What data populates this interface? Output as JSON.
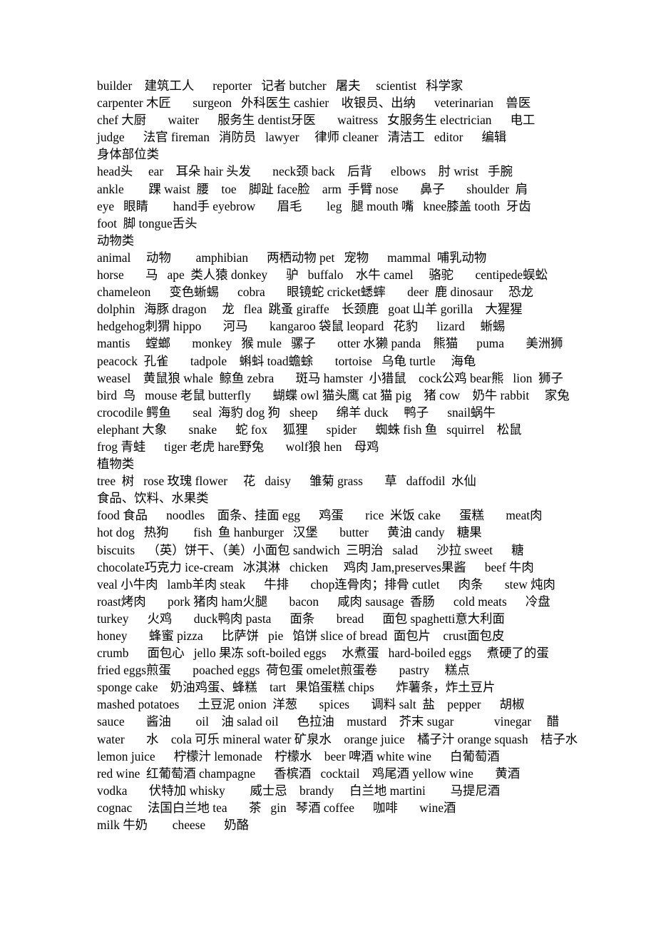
{
  "document": {
    "type": "vocabulary-word-list",
    "language_pair": "English-Chinese",
    "sections": [
      {
        "heading": null,
        "category_key": "occupations",
        "lines": [
          "builder    建筑工人      reporter   记者 butcher   屠夫     scientist   科学家",
          "carpenter 木匠       surgeon   外科医生 cashier    收银员、出纳      veterinarian    兽医",
          "chef 大厨       waiter      服务生 dentist牙医       waitress   女服务生 electrician      电工",
          "judge      法官 fireman   消防员   lawyer     律师 cleaner   清洁工   editor      编辑"
        ]
      },
      {
        "heading": "身体部位类",
        "category_key": "body-parts",
        "lines": [
          "head头     ear    耳朵 hair 头发       neck颈 back    后背      elbows    肘 wrist   手腕",
          "ankle        踝 waist  腰    toe    脚趾 face脸    arm  手臂 nose       鼻子       shoulder  肩",
          "eye   眼睛        hand手 eyebrow       眉毛        leg   腿 mouth 嘴   knee膝盖 tooth  牙齿",
          "foot  脚 tongue舌头"
        ]
      },
      {
        "heading": "动物类",
        "category_key": "animals",
        "lines": [
          "animal     动物        amphibian      两栖动物 pet   宠物      mammal  哺乳动物",
          "horse       马   ape  类人猿 donkey      驴   buffalo    水牛 camel     骆驼       centipede蜈蚣",
          "chameleon      变色蜥蜴      cobra       眼镜蛇 cricket蟋蟀       deer  鹿 dinosaur     恐龙",
          "dolphin   海豚 dragon     龙   flea  跳蚤 giraffe    长颈鹿   goat 山羊 gorilla    大猩猩",
          "hedgehog刺猬 hippo       河马       kangaroo 袋鼠 leopard   花豹      lizard     蜥蜴",
          "mantis     螳螂       monkey   猴 mule   骡子       otter 水獭 panda    熊猫      puma       美洲狮",
          "peacock  孔雀       tadpole    蝌蚪 toad蟾蜍       tortoise   乌龟 turtle     海龟",
          "weasel    黄鼠狼 whale  鲸鱼 zebra       斑马 hamster  小猎鼠    cock公鸡 bear熊   lion  狮子",
          "bird  鸟   mouse 老鼠 butterfly       蝴蝶 owl 猫头鹰 cat 猫 pig    猪 cow    奶牛 rabbit     家兔",
          "crocodile 鳄鱼       seal  海豹 dog 狗   sheep      绵羊 duck     鸭子      snail蜗牛",
          "elephant 大象       snake      蛇 fox     狐狸      spider      蜘蛛 fish 鱼   squirrel    松鼠",
          "frog 青蛙      tiger 老虎 hare野兔       wolf狼 hen    母鸡"
        ]
      },
      {
        "heading": "植物类",
        "category_key": "plants",
        "lines": [
          "tree  树   rose 玫瑰 flower     花   daisy      雏菊 grass       草   daffodil  水仙"
        ]
      },
      {
        "heading": "食品、饮料、水果类",
        "category_key": "food-drink-fruit",
        "lines": [
          "food 食品      noodles    面条、挂面 egg      鸡蛋       rice  米饭 cake      蛋糕       meat肉",
          "hot dog   热狗        fish  鱼 hanburger   汉堡       butter      黄油 candy    糖果",
          "biscuits    （英）饼干、（美）小面包 sandwich  三明治   salad      沙拉 sweet      糖",
          "chocolate巧克力 ice-cream   冰淇淋   chicken     鸡肉 Jam,preserves果酱      beef 牛肉",
          "veal 小牛肉   lamb羊肉 steak      牛排       chop连骨肉；排骨 cutlet      肉条       stew 炖肉",
          "roast烤肉       pork 猪肉 ham火腿       bacon      咸肉 sausage  香肠      cold meats      冷盘",
          "turkey      火鸡       duck鸭肉 pasta      面条       bread      面包 spaghetti意大利面",
          "honey       蜂蜜 pizza      比萨饼   pie   馅饼 slice of bread  面包片    crust面包皮",
          "crumb      面包心   jello 果冻 soft-boiled eggs     水煮蛋   hard-boiled eggs     煮硬了的蛋",
          "fried eggs煎蛋       poached eggs  荷包蛋 omelet煎蛋卷       pastry     糕点",
          "sponge cake    奶油鸡蛋、蜂糕    tart   果馅蛋糕 chips       炸薯条，炸土豆片",
          "mashed potatoes      土豆泥 onion  洋葱       spices       调料 salt  盐    pepper      胡椒",
          "sauce       酱油        oil    油 salad oil      色拉油    mustard    芥末 sugar             vinegar     醋",
          "water       水    cola 可乐 mineral water 矿泉水    orange juice    橘子汁 orange squash    桔子水",
          "lemon juice      柠檬汁 lemonade    柠檬水    beer 啤酒 white wine      白葡萄酒",
          "red wine  红葡萄酒 champagne      香槟酒   cocktail    鸡尾酒 yellow wine       黄酒",
          "vodka       伏特加 whisky        威士忌    brandy     白兰地 martini        马提尼酒",
          "cognac     法国白兰地 tea       茶   gin   琴酒 coffee      咖啡       wine酒",
          "milk 牛奶        cheese      奶酪"
        ]
      }
    ]
  }
}
